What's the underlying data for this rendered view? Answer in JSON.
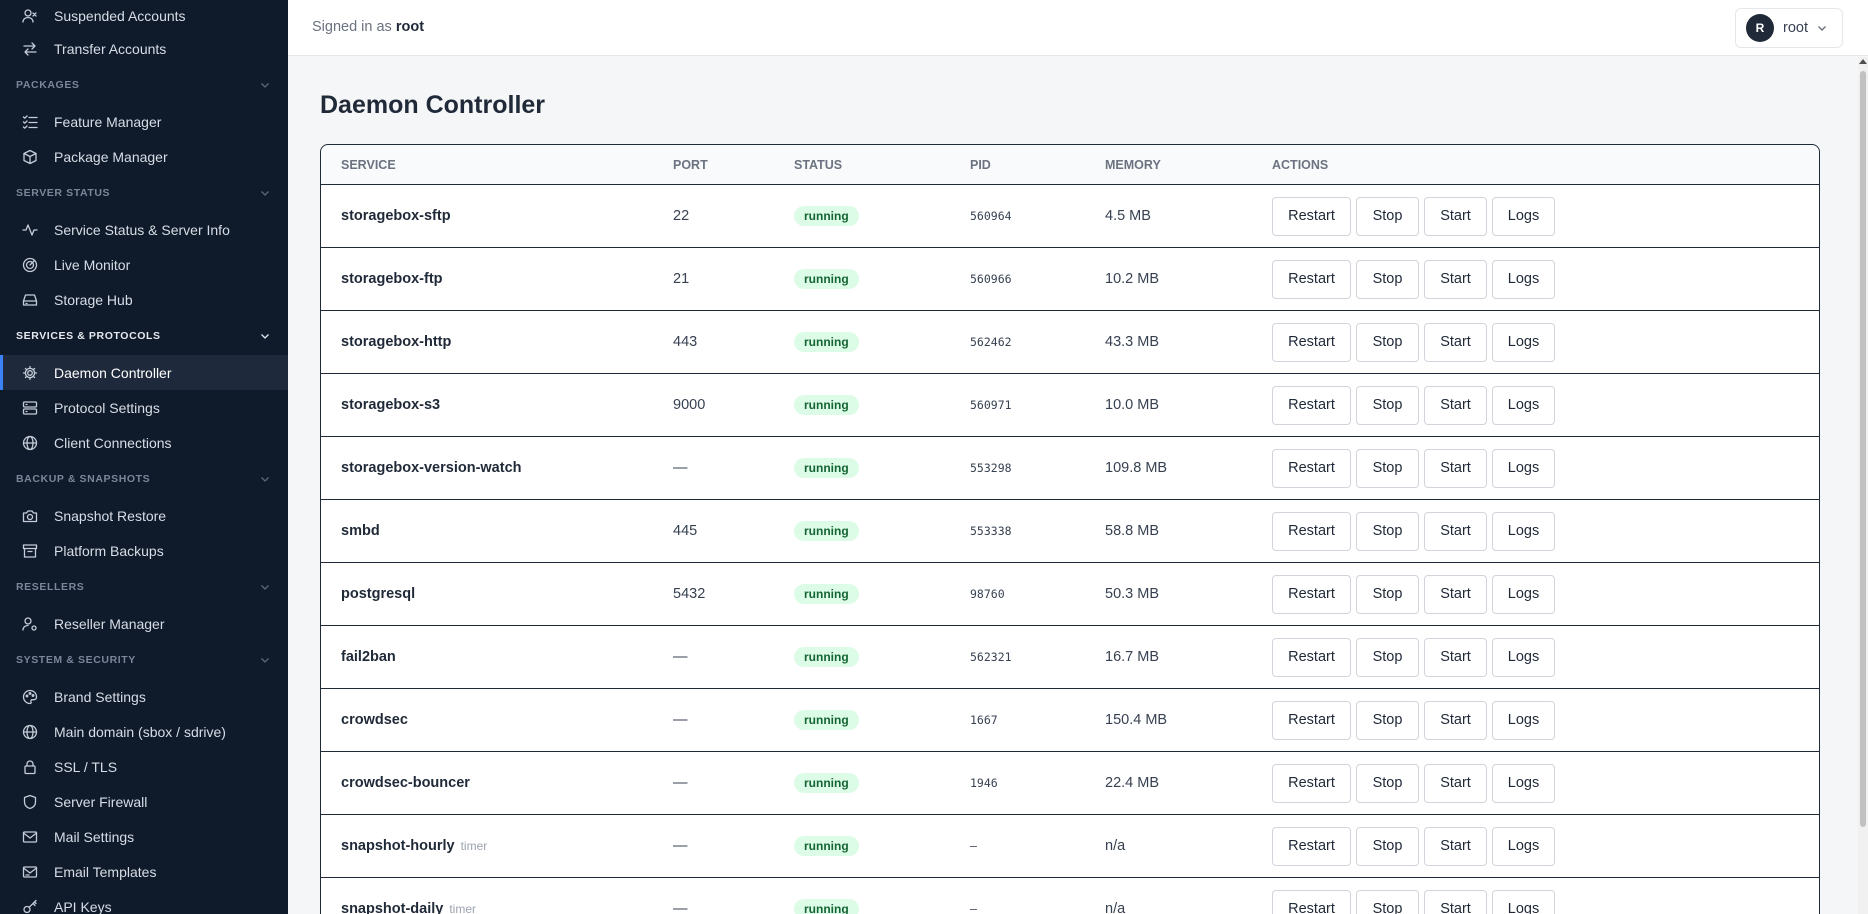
{
  "sidebar": {
    "top_items": [
      {
        "label": "Suspended Accounts",
        "icon": "user-x-icon"
      },
      {
        "label": "Transfer Accounts",
        "icon": "arrows-swap-icon"
      }
    ],
    "sections": [
      {
        "title": "PACKAGES",
        "items": [
          {
            "label": "Feature Manager",
            "icon": "list-check-icon"
          },
          {
            "label": "Package Manager",
            "icon": "package-icon"
          }
        ]
      },
      {
        "title": "SERVER STATUS",
        "items": [
          {
            "label": "Service Status & Server Info",
            "icon": "activity-icon"
          },
          {
            "label": "Live Monitor",
            "icon": "radar-icon"
          },
          {
            "label": "Storage Hub",
            "icon": "storage-drive-icon"
          }
        ]
      },
      {
        "title": "SERVICES & PROTOCOLS",
        "items": [
          {
            "label": "Daemon Controller",
            "icon": "gear-icon"
          },
          {
            "label": "Protocol Settings",
            "icon": "server-icon"
          },
          {
            "label": "Client Connections",
            "icon": "globe-icon"
          }
        ]
      },
      {
        "title": "BACKUP & SNAPSHOTS",
        "items": [
          {
            "label": "Snapshot Restore",
            "icon": "camera-icon"
          },
          {
            "label": "Platform Backups",
            "icon": "archive-icon"
          }
        ]
      },
      {
        "title": "RESELLERS",
        "items": [
          {
            "label": "Reseller Manager",
            "icon": "user-gear-icon"
          }
        ]
      },
      {
        "title": "SYSTEM & SECURITY",
        "items": [
          {
            "label": "Brand Settings",
            "icon": "palette-icon"
          },
          {
            "label": "Main domain (sbox / sdrive)",
            "icon": "globe-icon"
          },
          {
            "label": "SSL / TLS",
            "icon": "lock-icon"
          },
          {
            "label": "Server Firewall",
            "icon": "shield-icon"
          },
          {
            "label": "Mail Settings",
            "icon": "mail-icon"
          },
          {
            "label": "Email Templates",
            "icon": "mail-template-icon"
          },
          {
            "label": "API Keys",
            "icon": "key-icon"
          }
        ]
      }
    ],
    "active_item": "Daemon Controller"
  },
  "header": {
    "signed_in_prefix": "Signed in as",
    "username": "root",
    "avatar_initial": "R",
    "menu_user": "root"
  },
  "page": {
    "title": "Daemon Controller"
  },
  "table": {
    "columns": [
      "SERVICE",
      "PORT",
      "STATUS",
      "PID",
      "MEMORY",
      "ACTIONS"
    ],
    "actions": [
      "Restart",
      "Stop",
      "Start",
      "Logs"
    ],
    "rows": [
      {
        "service": "storagebox-sftp",
        "tag": "",
        "port": "22",
        "status": "running",
        "pid": "560964",
        "memory": "4.5 MB"
      },
      {
        "service": "storagebox-ftp",
        "tag": "",
        "port": "21",
        "status": "running",
        "pid": "560966",
        "memory": "10.2 MB"
      },
      {
        "service": "storagebox-http",
        "tag": "",
        "port": "443",
        "status": "running",
        "pid": "562462",
        "memory": "43.3 MB"
      },
      {
        "service": "storagebox-s3",
        "tag": "",
        "port": "9000",
        "status": "running",
        "pid": "560971",
        "memory": "10.0 MB"
      },
      {
        "service": "storagebox-version-watch",
        "tag": "",
        "port": "—",
        "status": "running",
        "pid": "553298",
        "memory": "109.8 MB"
      },
      {
        "service": "smbd",
        "tag": "",
        "port": "445",
        "status": "running",
        "pid": "553338",
        "memory": "58.8 MB"
      },
      {
        "service": "postgresql",
        "tag": "",
        "port": "5432",
        "status": "running",
        "pid": "98760",
        "memory": "50.3 MB"
      },
      {
        "service": "fail2ban",
        "tag": "",
        "port": "—",
        "status": "running",
        "pid": "562321",
        "memory": "16.7 MB"
      },
      {
        "service": "crowdsec",
        "tag": "",
        "port": "—",
        "status": "running",
        "pid": "1667",
        "memory": "150.4 MB"
      },
      {
        "service": "crowdsec-bouncer",
        "tag": "",
        "port": "—",
        "status": "running",
        "pid": "1946",
        "memory": "22.4 MB"
      },
      {
        "service": "snapshot-hourly",
        "tag": "timer",
        "port": "—",
        "status": "running",
        "pid": "–",
        "memory": "n/a"
      },
      {
        "service": "snapshot-daily",
        "tag": "timer",
        "port": "—",
        "status": "running",
        "pid": "–",
        "memory": "n/a"
      }
    ]
  },
  "colors": {
    "sidebar_bg": "#0f1a2b",
    "active_accent": "#3b82f6",
    "badge_bg": "#dcfce7",
    "badge_text": "#166534"
  }
}
